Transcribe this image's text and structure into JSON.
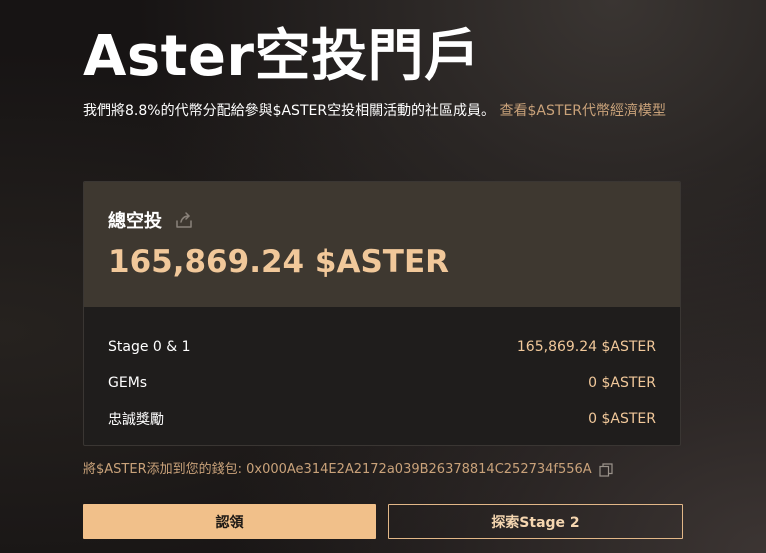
{
  "page": {
    "title": "Aster空投門戶",
    "description": "我們將8.8%的代幣分配給參與$ASTER空投相關活動的社區成員。",
    "tokenomics_link": "查看$ASTER代幣經濟模型"
  },
  "summary": {
    "label": "總空投",
    "share_icon": "share-icon",
    "total": "165,869.24 $ASTER"
  },
  "breakdown": [
    {
      "label": "Stage 0 & 1",
      "value": "165,869.24 $ASTER"
    },
    {
      "label": "GEMs",
      "value": "0 $ASTER"
    },
    {
      "label": "忠誠獎勵",
      "value": "0 $ASTER"
    }
  ],
  "wallet": {
    "text": "將$ASTER添加到您的錢包: 0x000Ae314E2A2172a039B26378814C252734f556A",
    "copy_icon": "copy-icon"
  },
  "actions": {
    "claim_label": "認領",
    "explore_label": "探索Stage 2"
  },
  "colors": {
    "accent": "#f1c08a",
    "accent_text": "#f1c89a",
    "link": "#c9a27a",
    "card_header": "#3e3830",
    "card_body": "#1f1d1c"
  }
}
